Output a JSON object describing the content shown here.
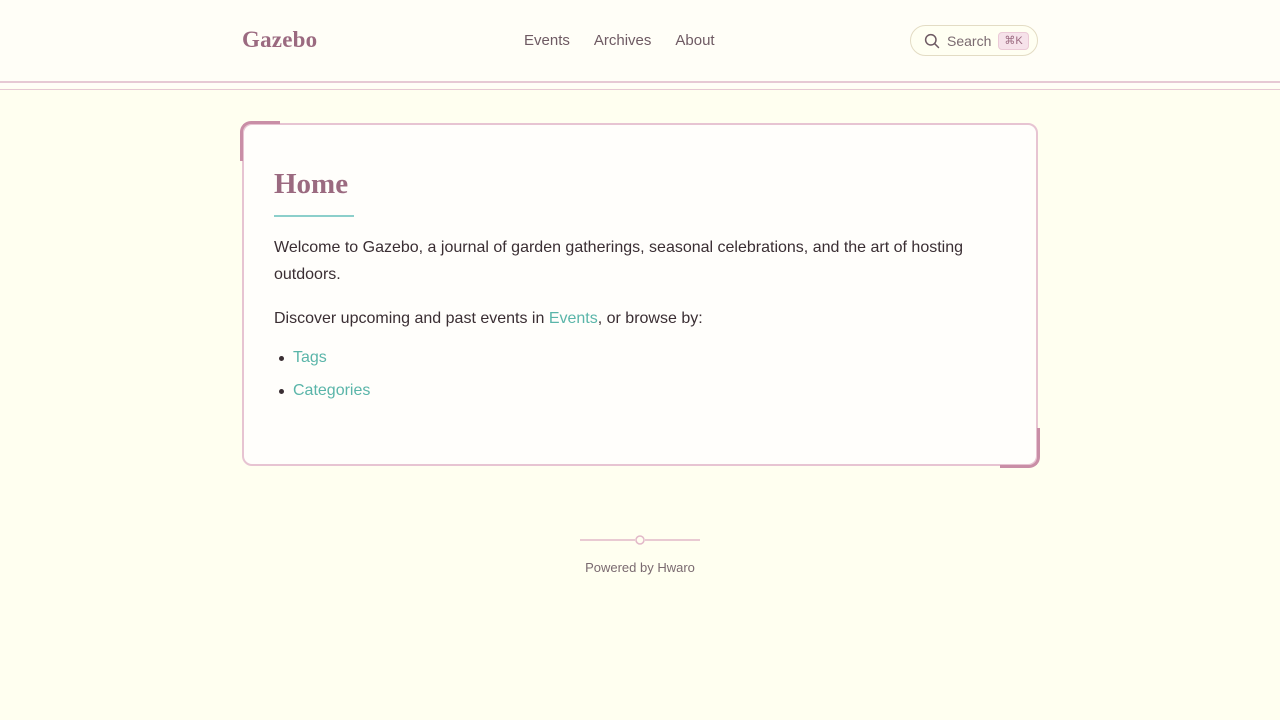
{
  "header": {
    "brand": "Gazebo",
    "nav": [
      {
        "label": "Events"
      },
      {
        "label": "Archives"
      },
      {
        "label": "About"
      }
    ],
    "search": {
      "label": "Search",
      "shortcut": "⌘K",
      "icon": "search-icon"
    }
  },
  "main": {
    "title": "Home",
    "intro": "Welcome to Gazebo, a journal of garden gatherings, seasonal celebrations, and the art of hosting outdoors.",
    "discover_prefix": "Discover upcoming and past events in ",
    "discover_link": "Events",
    "discover_suffix": ", or browse by:",
    "browse_links": [
      {
        "label": "Tags"
      },
      {
        "label": "Categories"
      }
    ]
  },
  "footer": {
    "powered_prefix": "Powered by ",
    "powered_link": "Hwaro"
  },
  "colors": {
    "background": "#fffff0",
    "brand": "#9b6a80",
    "border": "#e7c4d2",
    "accent_link": "#5ab5a9",
    "title_rule": "#8ccfcb"
  }
}
